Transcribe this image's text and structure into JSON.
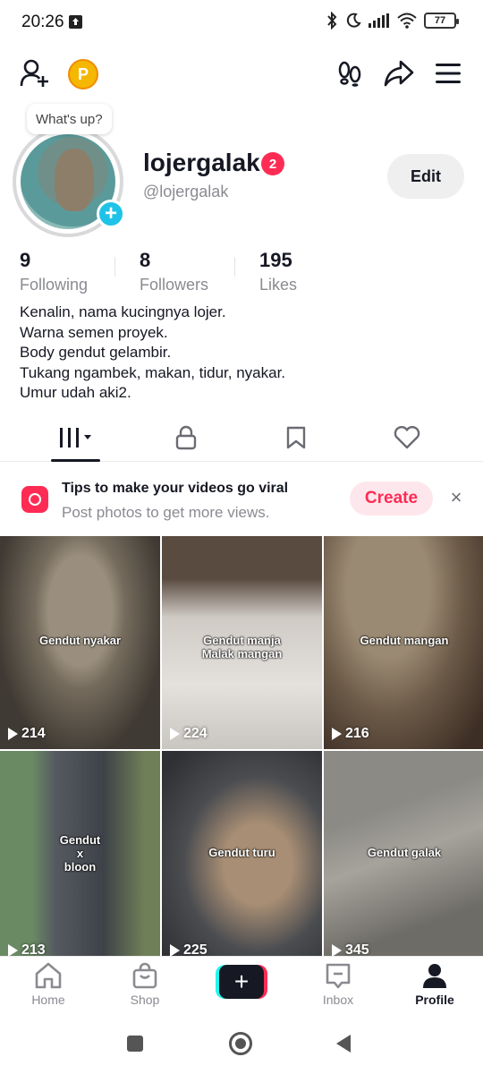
{
  "status_bar": {
    "time": "20:26",
    "battery": "77"
  },
  "whats_up": "What's up?",
  "profile": {
    "username": "lojergalak",
    "notification_count": "2",
    "handle": "@lojergalak",
    "edit_label": "Edit",
    "stats": [
      {
        "value": "9",
        "label": "Following"
      },
      {
        "value": "8",
        "label": "Followers"
      },
      {
        "value": "195",
        "label": "Likes"
      }
    ],
    "bio": [
      "Kenalin, nama kucingnya lojer.",
      "Warna semen proyek.",
      "Body gendut gelambir.",
      "Tukang ngambek, makan, tidur, nyakar.",
      "Umur udah aki2."
    ]
  },
  "coin_letter": "P",
  "tips": {
    "title": "Tips to make your videos go viral",
    "subtitle": "Post photos to get more views.",
    "create_label": "Create",
    "close_glyph": "×"
  },
  "videos": [
    {
      "caption": "Gendut nyakar",
      "views": "214"
    },
    {
      "caption": "Gendut manja\nMalak mangan",
      "views": "224"
    },
    {
      "caption": "Gendut mangan",
      "views": "216"
    },
    {
      "caption": "Gendut\nx\nbloon",
      "views": "213"
    },
    {
      "caption": "Gendut turu",
      "views": "225"
    },
    {
      "caption": "Gendut galak",
      "views": "345"
    }
  ],
  "bottom_nav": {
    "home": "Home",
    "shop": "Shop",
    "add": "+",
    "inbox": "Inbox",
    "profile": "Profile"
  },
  "colors": {
    "accent": "#fe2c55",
    "cyan": "#25f4ee",
    "text": "#161823",
    "muted": "#8a8b91"
  }
}
